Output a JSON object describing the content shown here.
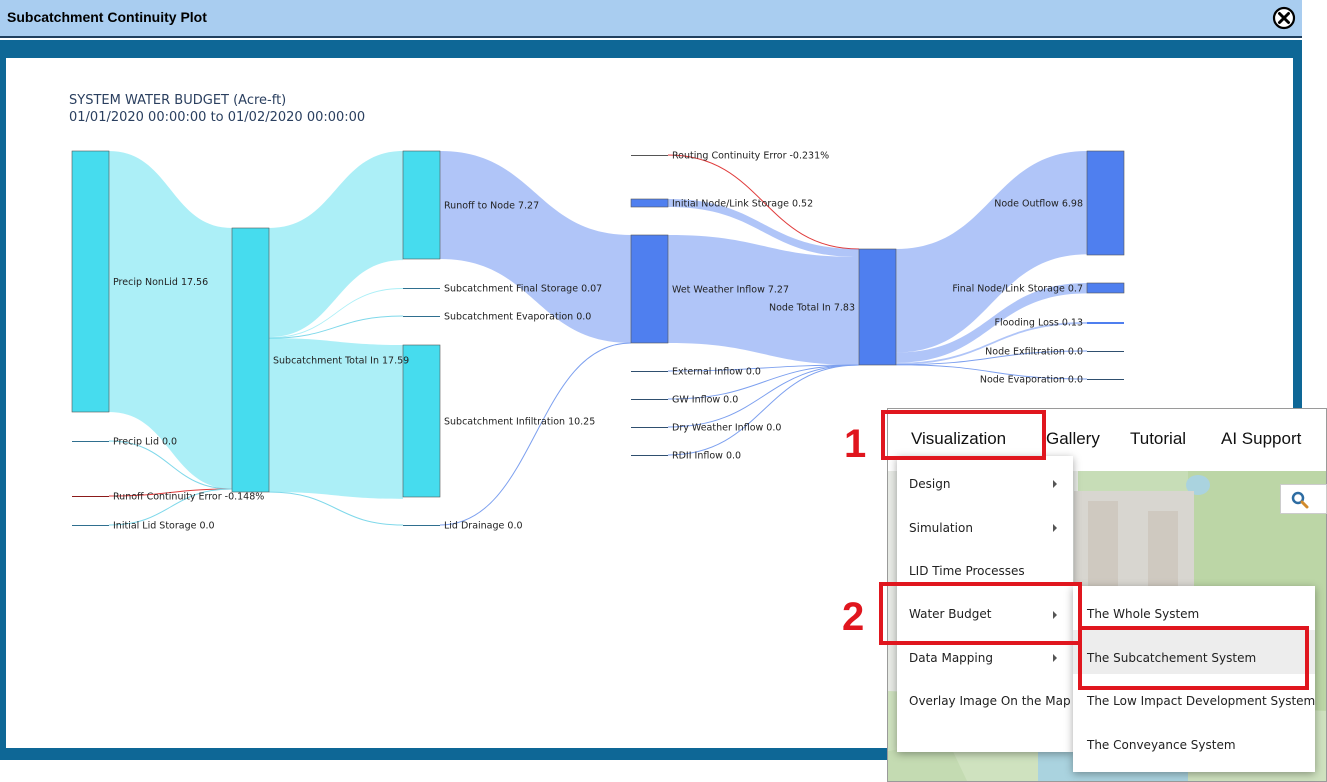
{
  "window": {
    "title": "Subcatchment Continuity Plot",
    "close_icon": "close-circle-icon"
  },
  "chart_data": {
    "type": "sankey",
    "title": "SYSTEM WATER BUDGET (Acre-ft)",
    "subtitle": "01/01/2020 00:00:00 to 01/02/2020 00:00:00",
    "nodes": [
      {
        "id": "precip_nonlid",
        "label": "Precip NonLid 17.56",
        "value": 17.56,
        "color": "#46dcee"
      },
      {
        "id": "precip_lid",
        "label": "Precip Lid 0.0",
        "value": 0.0,
        "color": "#2f6f8f"
      },
      {
        "id": "runoff_cont_err",
        "label": "Runoff Continuity Error -0.148%",
        "value": -0.148,
        "color": "#8b1a1a"
      },
      {
        "id": "init_lid_storage",
        "label": "Initial Lid Storage 0.0",
        "value": 0.0,
        "color": "#2f6f8f"
      },
      {
        "id": "subcatch_total_in",
        "label": "Subcatchment Total In 17.59",
        "value": 17.59,
        "color": "#46dcee"
      },
      {
        "id": "runoff_to_node",
        "label": "Runoff to Node 7.27",
        "value": 7.27,
        "color": "#46dcee"
      },
      {
        "id": "subcatch_final_storage",
        "label": "Subcatchment Final Storage 0.07",
        "value": 0.07,
        "color": "#2f6f8f"
      },
      {
        "id": "subcatch_evap",
        "label": "Subcatchment Evaporation 0.0",
        "value": 0.0,
        "color": "#2f6f8f"
      },
      {
        "id": "subcatch_infil",
        "label": "Subcatchment Infiltration 10.25",
        "value": 10.25,
        "color": "#46dcee"
      },
      {
        "id": "lid_drainage",
        "label": "Lid Drainage 0.0",
        "value": 0.0,
        "color": "#2f6f8f"
      },
      {
        "id": "routing_cont_err",
        "label": "Routing Continuity Error -0.231%",
        "value": -0.231,
        "color": "#555555"
      },
      {
        "id": "init_node_link_storage",
        "label": "Initial Node/Link Storage 0.52",
        "value": 0.52,
        "color": "#4f7fef"
      },
      {
        "id": "wet_weather_inflow",
        "label": "Wet Weather Inflow 7.27",
        "value": 7.27,
        "color": "#4f7fef"
      },
      {
        "id": "external_inflow",
        "label": "External Inflow 0.0",
        "value": 0.0,
        "color": "#2f4f6f"
      },
      {
        "id": "gw_inflow",
        "label": "GW Inflow 0.0",
        "value": 0.0,
        "color": "#2f4f6f"
      },
      {
        "id": "dry_weather_inflow",
        "label": "Dry Weather Inflow 0.0",
        "value": 0.0,
        "color": "#2f4f6f"
      },
      {
        "id": "rdii_inflow",
        "label": "RDII Inflow 0.0",
        "value": 0.0,
        "color": "#2f4f6f"
      },
      {
        "id": "node_total_in",
        "label": "Node Total In 7.83",
        "value": 7.83,
        "color": "#4f7fef"
      },
      {
        "id": "node_outflow",
        "label": "Node Outflow 6.98",
        "value": 6.98,
        "color": "#4f7fef"
      },
      {
        "id": "final_node_link_storage",
        "label": "Final Node/Link Storage 0.7",
        "value": 0.7,
        "color": "#4f7fef"
      },
      {
        "id": "flooding_loss",
        "label": "Flooding Loss 0.13",
        "value": 0.13,
        "color": "#4f7fef"
      },
      {
        "id": "node_exfiltration",
        "label": "Node Exfiltration 0.0",
        "value": 0.0,
        "color": "#2f4f6f"
      },
      {
        "id": "node_evaporation",
        "label": "Node Evaporation 0.0",
        "value": 0.0,
        "color": "#2f4f6f"
      }
    ],
    "links": [
      {
        "source": "precip_nonlid",
        "target": "subcatch_total_in",
        "value": 17.56
      },
      {
        "source": "precip_lid",
        "target": "subcatch_total_in",
        "value": 0.0
      },
      {
        "source": "runoff_cont_err",
        "target": "subcatch_total_in",
        "value": 0.0
      },
      {
        "source": "init_lid_storage",
        "target": "subcatch_total_in",
        "value": 0.0
      },
      {
        "source": "subcatch_total_in",
        "target": "runoff_to_node",
        "value": 7.27
      },
      {
        "source": "subcatch_total_in",
        "target": "subcatch_final_storage",
        "value": 0.07
      },
      {
        "source": "subcatch_total_in",
        "target": "subcatch_evap",
        "value": 0.0
      },
      {
        "source": "subcatch_total_in",
        "target": "subcatch_infil",
        "value": 10.25
      },
      {
        "source": "subcatch_total_in",
        "target": "lid_drainage",
        "value": 0.0
      },
      {
        "source": "runoff_to_node",
        "target": "wet_weather_inflow",
        "value": 7.27
      },
      {
        "source": "lid_drainage",
        "target": "wet_weather_inflow",
        "value": 0.0
      },
      {
        "source": "routing_cont_err",
        "target": "node_total_in",
        "value": 0.0
      },
      {
        "source": "init_node_link_storage",
        "target": "node_total_in",
        "value": 0.52
      },
      {
        "source": "wet_weather_inflow",
        "target": "node_total_in",
        "value": 7.27
      },
      {
        "source": "external_inflow",
        "target": "node_total_in",
        "value": 0.0
      },
      {
        "source": "gw_inflow",
        "target": "node_total_in",
        "value": 0.0
      },
      {
        "source": "dry_weather_inflow",
        "target": "node_total_in",
        "value": 0.0
      },
      {
        "source": "rdii_inflow",
        "target": "node_total_in",
        "value": 0.0
      },
      {
        "source": "node_total_in",
        "target": "node_outflow",
        "value": 6.98
      },
      {
        "source": "node_total_in",
        "target": "final_node_link_storage",
        "value": 0.7
      },
      {
        "source": "node_total_in",
        "target": "flooding_loss",
        "value": 0.13
      },
      {
        "source": "node_total_in",
        "target": "node_exfiltration",
        "value": 0.0
      },
      {
        "source": "node_total_in",
        "target": "node_evaporation",
        "value": 0.0
      }
    ]
  },
  "annotations": {
    "step1": "1",
    "step2": "2"
  },
  "nav": {
    "visualization": "Visualization",
    "gallery": "Gallery",
    "tutorial": "Tutorial",
    "ai_support": "AI Support"
  },
  "dropdown": {
    "items": [
      "Design",
      "Simulation",
      "LID Time Processes",
      "Water Budget",
      "Data Mapping",
      "Overlay Image On the Map"
    ]
  },
  "submenu": {
    "items": [
      "The Whole System",
      "The Subcatchement System",
      "The Low Impact Development System",
      "The Conveyance System"
    ]
  },
  "map": {
    "search_icon": "search-icon"
  },
  "colors": {
    "accent_red": "#e0161e",
    "frame_blue": "#0e6796",
    "titlebar_blue": "#a9cdf0"
  }
}
